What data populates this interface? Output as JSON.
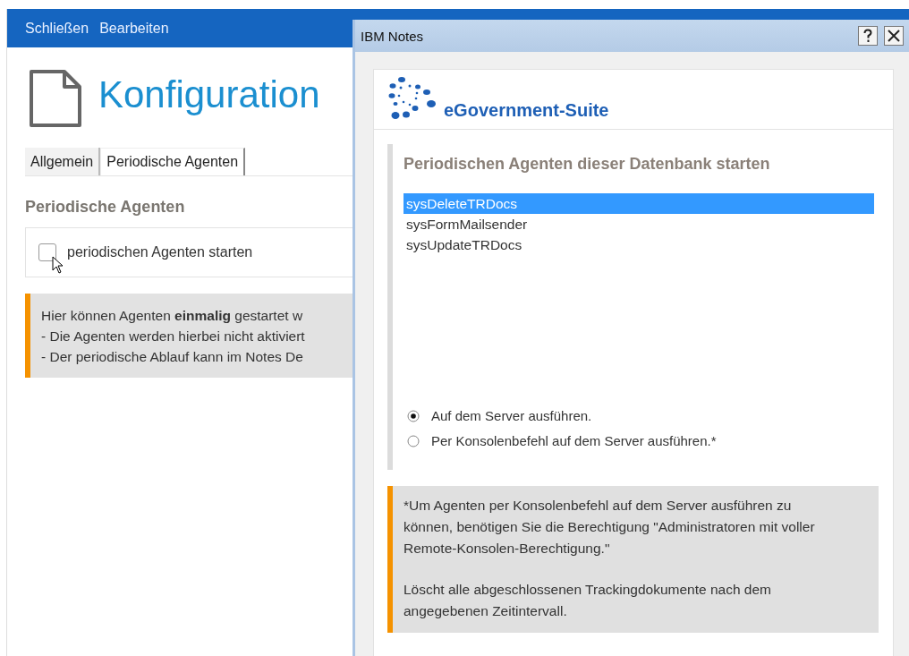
{
  "menu": [
    {
      "label": "Schließen"
    },
    {
      "label": "Bearbeiten"
    }
  ],
  "page": {
    "title": "Konfiguration",
    "tabs": [
      {
        "label": "Allgemein",
        "selected": false
      },
      {
        "label": "Periodische Agenten",
        "selected": true
      }
    ],
    "section_heading": "Periodische Agenten",
    "checkbox": {
      "label": "periodischen Agenten starten",
      "checked": false
    },
    "info_lines": [
      "Hier können Agenten **einmalig** gestartet w",
      "- Die Agenten werden hierbei nicht aktiviert",
      "- Der periodische Ablauf kann im Notes De"
    ]
  },
  "dialog": {
    "title": "IBM Notes",
    "logo_text": "eGovernment-Suite",
    "heading": "Periodischen Agenten dieser Datenbank starten",
    "agents": [
      {
        "label": "sysDeleteTRDocs",
        "selected": true
      },
      {
        "label": "sysFormMailsender",
        "selected": false
      },
      {
        "label": "sysUpdateTRDocs",
        "selected": false
      }
    ],
    "run_options": [
      {
        "label": "Auf dem Server ausführen.",
        "selected": true
      },
      {
        "label": "Per Konsolenbefehl auf dem Server ausführen.*",
        "selected": false
      }
    ],
    "note_paragraphs": [
      "*Um Agenten per Konsolenbefehl auf dem Server ausführen zu können, benötigen Sie die Berechtigung \"Administratoren mit voller Remote-Konsolen-Berechtigung.\"",
      "Löscht alle abgeschlossenen Trackingdokumente nach dem angegebenen Zeitintervall."
    ]
  }
}
